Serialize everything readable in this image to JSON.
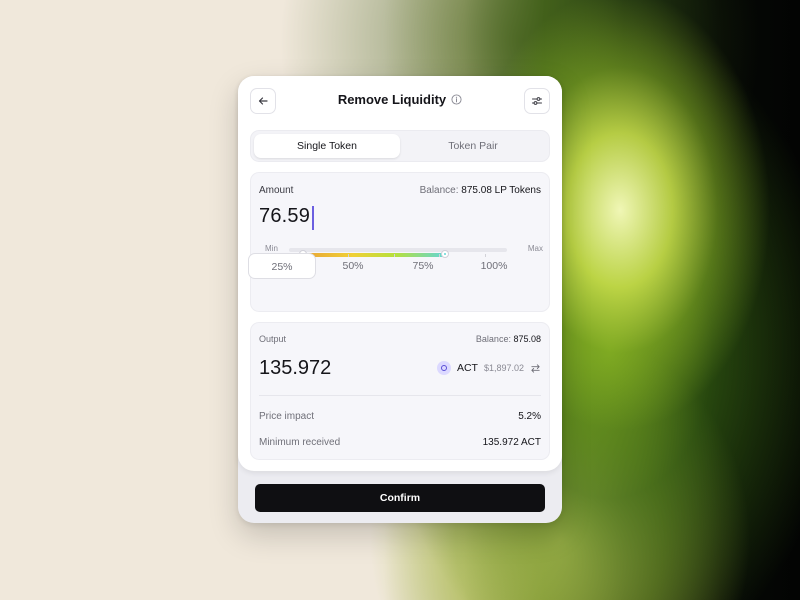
{
  "header": {
    "title": "Remove Liquidity",
    "back_icon": "arrow-left-icon",
    "info_icon": "info-icon",
    "settings_icon": "sliders-icon"
  },
  "tabs": [
    {
      "label": "Single Token",
      "active": true
    },
    {
      "label": "Token Pair",
      "active": false
    }
  ],
  "amount": {
    "label": "Amount",
    "balance_label": "Balance:",
    "balance_value": "875.08 LP Tokens",
    "value": "76.59",
    "slider": {
      "min_label": "Min",
      "max_label": "Max"
    },
    "percent_options": [
      {
        "label": "25%",
        "selected": true
      },
      {
        "label": "50%",
        "selected": false
      },
      {
        "label": "75%",
        "selected": false
      },
      {
        "label": "100%",
        "selected": false
      }
    ]
  },
  "output": {
    "label": "Output",
    "balance_label": "Balance:",
    "balance_value": "875.08",
    "value": "135.972",
    "token": {
      "symbol": "ACT",
      "usd_value": "$1,897.02",
      "icon": "act-token-icon",
      "swap_icon": "swap-arrows-icon"
    },
    "price_impact_label": "Price impact",
    "price_impact_value": "5.2%",
    "min_received_label": "Minimum received",
    "min_received_value": "135.972 ACT"
  },
  "confirm_label": "Confirm",
  "colors": {
    "accent_caret": "#6b5fe0",
    "confirm_bg": "#0f0f12",
    "slider_gradient": [
      "#e8a437",
      "#f0d035",
      "#b6e03c",
      "#62d6d6"
    ]
  }
}
